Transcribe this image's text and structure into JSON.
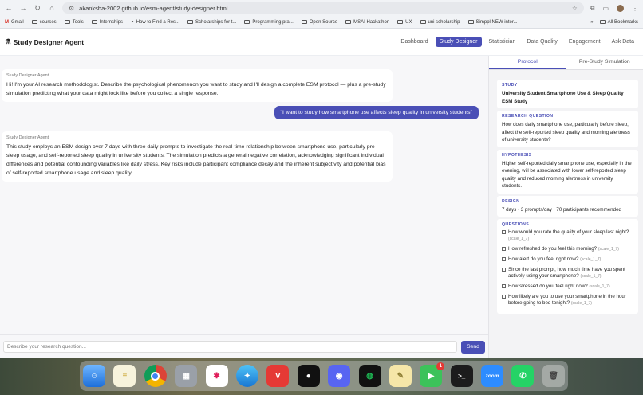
{
  "browser": {
    "url": "akanksha-2002.github.io/esm-agent/study-designer.html",
    "bookmarks": [
      "Gmail",
      "courses",
      "Tools",
      "Internships",
      "How to Find a Res...",
      "Scholarships for t...",
      "Programming pra...",
      "Open Source",
      "MSAI Hackathon",
      "UX",
      "uni scholarship",
      "Simppl NEW inter..."
    ],
    "all_bookmarks": "All Bookmarks"
  },
  "app": {
    "title": "Study Designer Agent",
    "nav": [
      "Dashboard",
      "Study Designer",
      "Statistician",
      "Data Quality",
      "Engagement",
      "Ask Data"
    ]
  },
  "chat": {
    "agent_label": "Study Designer Agent",
    "intro": "Hi! I'm your AI research methodologist. Describe the psychological phenomenon you want to study and I'll design a complete ESM protocol — plus a pre-study simulation predicting what your data might look like before you collect a single response.",
    "user_message": "\"I want to study how smartphone use affects sleep quality in university students\"",
    "response": "This study employs an ESM design over 7 days with three daily prompts to investigate the real-time relationship between smartphone use, particularly pre-sleep usage, and self-reported sleep quality in university students. The simulation predicts a general negative correlation, acknowledging significant individual differences and potential confounding variables like daily stress. Key risks include participant compliance decay and the inherent subjectivity and potential bias of self-reported smartphone usage and sleep quality.",
    "input_placeholder": "Describe your research question...",
    "send_label": "Send"
  },
  "panel": {
    "tabs": [
      "Protocol",
      "Pre-Study Simulation"
    ],
    "study_label": "STUDY",
    "study_value": "University Student Smartphone Use & Sleep Quality ESM Study",
    "rq_label": "RESEARCH QUESTION",
    "rq_value": "How does daily smartphone use, particularly before sleep, affect the self-reported sleep quality and morning alertness of university students?",
    "hyp_label": "HYPOTHESIS",
    "hyp_value": "Higher self-reported daily smartphone use, especially in the evening, will be associated with lower self-reported sleep quality and reduced morning alertness in university students.",
    "design_label": "DESIGN",
    "design_value": "7 days · 3 prompts/day · 70 participants recommended",
    "questions_label": "QUESTIONS",
    "questions": [
      {
        "text": "How would you rate the quality of your sleep last night?",
        "scale": "(scale_1_7)"
      },
      {
        "text": "How refreshed do you feel this morning?",
        "scale": "(scale_1_7)"
      },
      {
        "text": "How alert do you feel right now?",
        "scale": "(scale_1_7)"
      },
      {
        "text": "Since the last prompt, how much time have you spent actively using your smartphone?",
        "scale": "(scale_1_7)"
      },
      {
        "text": "How stressed do you feel right now?",
        "scale": "(scale_1_7)"
      },
      {
        "text": "How likely are you to use your smartphone in the hour before going to bed tonight?",
        "scale": "(scale_1_7)"
      }
    ]
  },
  "dock": {
    "facetime_badge": "1",
    "zoom_label": "zoom"
  }
}
